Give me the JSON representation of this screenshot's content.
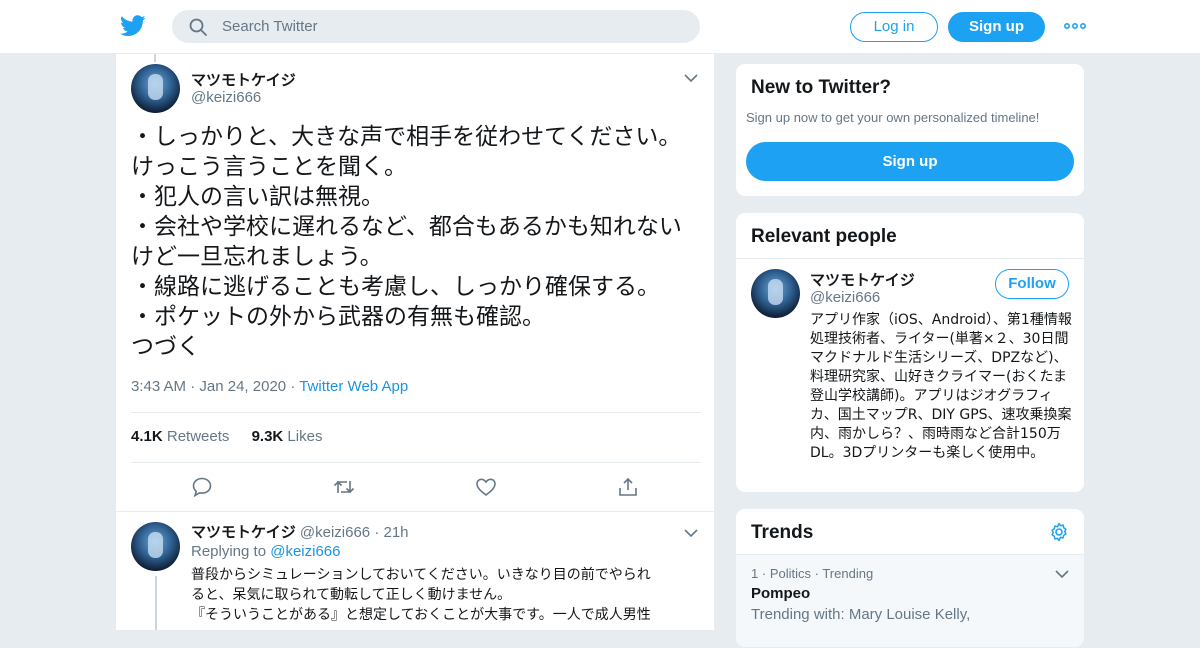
{
  "header": {
    "search_placeholder": "Search Twitter",
    "login_label": "Log in",
    "signup_label": "Sign up"
  },
  "tweet": {
    "author_name": "マツモトケイジ",
    "author_handle": "@keizi666",
    "text": "・しっかりと、大きな声で相手を従わせてください。\nけっこう言うことを聞く。\n・犯人の言い訳は無視。\n・会社や学校に遅れるなど、都合もあるかも知れない\nけど一旦忘れましょう。\n・線路に逃げることも考慮し、しっかり確保する。\n・ポケットの外から武器の有無も確認。\nつづく",
    "time": "3:43 AM",
    "date": "Jan 24, 2020",
    "source": "Twitter Web App",
    "retweets_count": "4.1K",
    "retweets_label": "Retweets",
    "likes_count": "9.3K",
    "likes_label": "Likes"
  },
  "reply": {
    "author_name": "マツモトケイジ",
    "author_handle": "@keizi666",
    "age": "21h",
    "replying_prefix": "Replying to",
    "replying_handle": "@keizi666",
    "text_line1": "普段からシミュレーションしておいてください。いきなり目の前でやられ",
    "text_line2": "ると、呆気に取られて動転して正しく動けません。",
    "text_line3": "『そういうことがある』と想定しておくことが大事です。一人で成人男性"
  },
  "new_to_twitter": {
    "title": "New to Twitter?",
    "subtitle": "Sign up now to get your own personalized timeline!",
    "signup_label": "Sign up"
  },
  "relevant_people": {
    "title": "Relevant people",
    "name": "マツモトケイジ",
    "handle": "@keizi666",
    "follow_label": "Follow",
    "bio": "アプリ作家（iOS、Android）、第1種情報処理技術者、ライター(単著×２、30日間マクドナルド生活シリーズ、DPZなど)、料理研究家、山好きクライマー(おくたま登山学校講師)。アプリはジオグラフィカ、国土マップR、DIY GPS、速攻乗換案内、雨かしら？、雨時雨など合計150万DL。3Dプリンターも楽しく使用中。"
  },
  "trends": {
    "title": "Trends",
    "item_rank": "1",
    "item_category": "Politics",
    "item_status": "Trending",
    "item_name": "Pompeo",
    "item_with": "Trending with: Mary Louise Kelly,"
  },
  "colors": {
    "brand": "#1da1f2",
    "background": "#e6ecf0",
    "secondary_text": "#657786"
  },
  "icons": [
    "twitter-bird-icon",
    "search-icon",
    "more-icon",
    "chevron-down-icon",
    "reply-icon",
    "retweet-icon",
    "like-icon",
    "share-icon",
    "gear-icon"
  ]
}
